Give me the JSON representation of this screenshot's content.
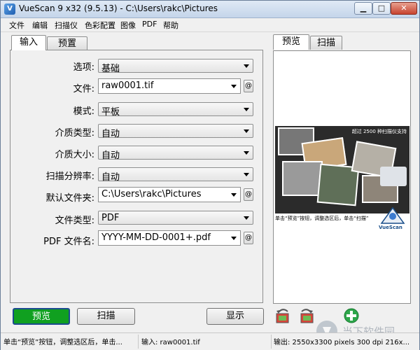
{
  "window": {
    "title": "VueScan 9 x32 (9.5.13) - C:\\Users\\rakc\\Pictures",
    "icon": "vuescan-app-icon",
    "controls": [
      "minimize-icon",
      "maximize-icon",
      "close-icon"
    ]
  },
  "menu": [
    "文件",
    "编辑",
    "扫描仪",
    "色彩配置",
    "图像",
    "PDF",
    "帮助"
  ],
  "left_tabs": [
    "输入",
    "预置"
  ],
  "right_tabs": [
    "预览",
    "扫描"
  ],
  "form": {
    "options": {
      "label": "选项:",
      "value": "基础"
    },
    "file": {
      "label": "文件:",
      "value": "raw0001.tif",
      "at": "@"
    },
    "mode": {
      "label": "模式:",
      "value": "平板"
    },
    "media_type": {
      "label": "介质类型:",
      "value": "自动"
    },
    "media_size": {
      "label": "介质大小:",
      "value": "自动"
    },
    "scan_resolution": {
      "label": "扫描分辨率:",
      "value": "自动"
    },
    "default_folder": {
      "label": "默认文件夹:",
      "value": "C:\\Users\\rakc\\Pictures",
      "at": "@"
    },
    "file_type": {
      "label": "文件类型:",
      "value": "PDF"
    },
    "pdf_filename": {
      "label": "PDF 文件名:",
      "value": "YYYY-MM-DD-0001+.pdf",
      "at": "@"
    }
  },
  "preview": {
    "banner": "超过 2500 种扫描仪支持",
    "caption": "单击“预览”按钮，调整选区后，单击“扫描”",
    "logo_text": "VueScan"
  },
  "buttons": {
    "preview": "预览",
    "scan": "扫描",
    "display": "显示"
  },
  "icon_buttons": [
    "rotate-left-icon",
    "rotate-right-icon",
    "add-icon"
  ],
  "status": {
    "hint": "单击“预览”按钮，调整选区后，单击...",
    "input": "输入: raw0001.tif",
    "output": "输出: 2550x3300 pixels 300 dpi 216x..."
  },
  "watermark": {
    "text": "当下软件园"
  },
  "colors": {
    "accent_green": "#10a020",
    "title_gradient_top": "#dfe9f5",
    "close_red": "#c7432f"
  }
}
